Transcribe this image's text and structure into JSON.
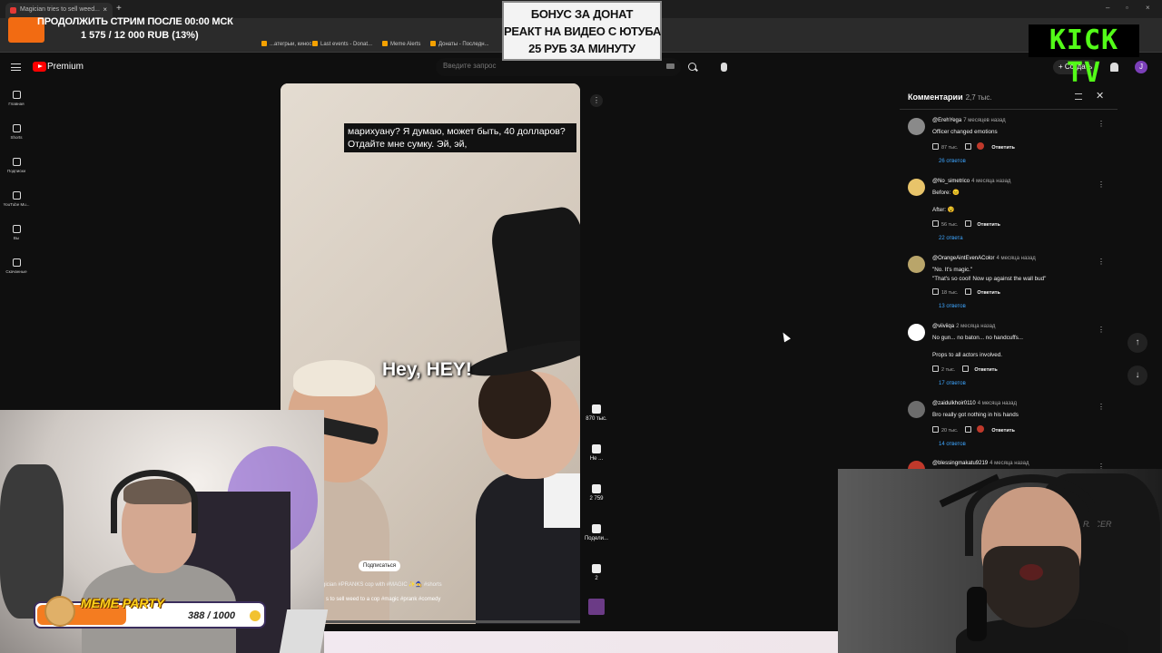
{
  "browser": {
    "tab_title": "Magician tries to sell weed...",
    "tab_close": "×",
    "new_tab": "+",
    "window_controls": [
      "–",
      "▫",
      "×"
    ],
    "bookmarks": [
      "...атегрыи, кинос...",
      "Last events - Donat...",
      "Meme Alerts",
      "Донаты - Последн..."
    ]
  },
  "stream_overlay": {
    "alert_line1": "ПРОДОЛЖИТЬ СТРИМ ПОСЛЕ 00:00 МСК",
    "alert_line2": "1 575 / 12 000 RUB (13%)",
    "donate_sign": [
      "БОНУС ЗА ДОНАТ",
      "РЕАКТ НА ВИДЕО С ЮТУБА",
      "25 РУБ ЗА МИНУТУ"
    ],
    "kick_logo": "KICK TV",
    "meme_party_title": "MEME PARTY",
    "meme_party_count": "388 / 1000",
    "meme_party_progress": 0.388
  },
  "youtube": {
    "brand": "Premium",
    "search_placeholder": "Введите запрос",
    "create_label": "+ Создать",
    "avatar_letter": "J",
    "sidenav": [
      {
        "label": "Главная",
        "icon": "home-icon"
      },
      {
        "label": "Shorts",
        "icon": "shorts-icon"
      },
      {
        "label": "Подписки",
        "icon": "subscriptions-icon"
      },
      {
        "label": "YouTube Mu...",
        "icon": "music-icon"
      },
      {
        "label": "Вы",
        "icon": "you-icon"
      },
      {
        "label": "Скачанные",
        "icon": "download-icon"
      }
    ]
  },
  "video": {
    "subtitle": "марихуану? Я думаю, может быть, 40 долларов? Отдайте мне сумку. Эй, эй,",
    "caption": "Hey, HEY!",
    "subscribe": "Подписаться",
    "title_line": "gician #PRANKS cop with #MAGIC ✨🧙 #shorts",
    "tags_line": "s to sell weed to a cop #magic #prank #comedy",
    "more": "⋮"
  },
  "actions": {
    "likes": "870 тыс.",
    "dislike": "Не ...",
    "comments": "2 759",
    "share": "Подели...",
    "remix": "2"
  },
  "comments": {
    "header": "Комментарии",
    "count": "2,7 тыс.",
    "close": "✕",
    "items": [
      {
        "author": "@ErehYega",
        "ago": "7 месяцев назад",
        "text": "Officer changed emotions",
        "likes": "87 тыс.",
        "reply": "Ответить",
        "replies": "26 ответов"
      },
      {
        "author": "@No_simetrico",
        "ago": "4 месяца назад",
        "text": "Before: 😐\n\nAfter: 😵",
        "likes": "56 тыс.",
        "reply": "Ответить",
        "replies": "22 ответа"
      },
      {
        "author": "@OrangeAintEvenAColor",
        "ago": "4 месяца назад",
        "text": "\"No. It's magic.\"\n\"That's so cool! Now up against the wall bud\"",
        "likes": "18 тыс.",
        "reply": "Ответить",
        "replies": "13 ответов"
      },
      {
        "author": "@viiviiqa",
        "ago": "2 месяца назад",
        "text": "No gun... no baton... no handcuffs...\n\nProps to all actors involved.",
        "likes": "2 тыс.",
        "reply": "Ответить",
        "replies": "17 ответов"
      },
      {
        "author": "@zaidulkhoir0110",
        "ago": "4 месяца назад",
        "text": "Bro really got nothing in his hands",
        "likes": "20 тыс.",
        "reply": "Ответить",
        "replies": "14 ответов"
      },
      {
        "author": "@blessingmakatu9219",
        "ago": "4 месяца назад",
        "text": "",
        "likes": "",
        "reply": "",
        "replies": ""
      }
    ],
    "nav_up": "↑",
    "nav_down": "↓"
  },
  "webcam": {
    "chair_brand": "RACER"
  }
}
